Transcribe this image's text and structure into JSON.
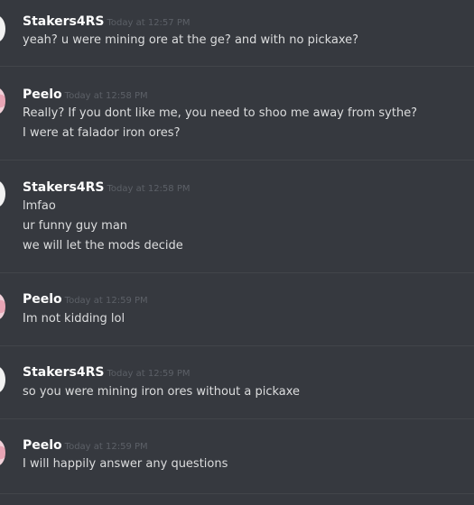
{
  "messages": [
    {
      "username": "Stakers4RS",
      "timestamp": "Today at 12:57 PM",
      "lines": [
        "yeah? u were mining ore at the ge? and with no pickaxe?"
      ]
    },
    {
      "username": "Peelo",
      "timestamp": "Today at 12:58 PM",
      "lines": [
        "Really? If you dont like me, you need to shoo me away from sythe?",
        "I were at falador iron ores?"
      ]
    },
    {
      "username": "Stakers4RS",
      "timestamp": "Today at 12:58 PM",
      "lines": [
        "lmfao",
        "ur funny guy man",
        "we will let the mods decide"
      ]
    },
    {
      "username": "Peelo",
      "timestamp": "Today at 12:59 PM",
      "lines": [
        "Im not kidding lol"
      ]
    },
    {
      "username": "Stakers4RS",
      "timestamp": "Today at 12:59 PM",
      "lines": [
        "so you were mining iron ores without a pickaxe"
      ]
    },
    {
      "username": "Peelo",
      "timestamp": "Today at 12:59 PM",
      "lines": [
        "I will happily answer any questions"
      ]
    }
  ]
}
